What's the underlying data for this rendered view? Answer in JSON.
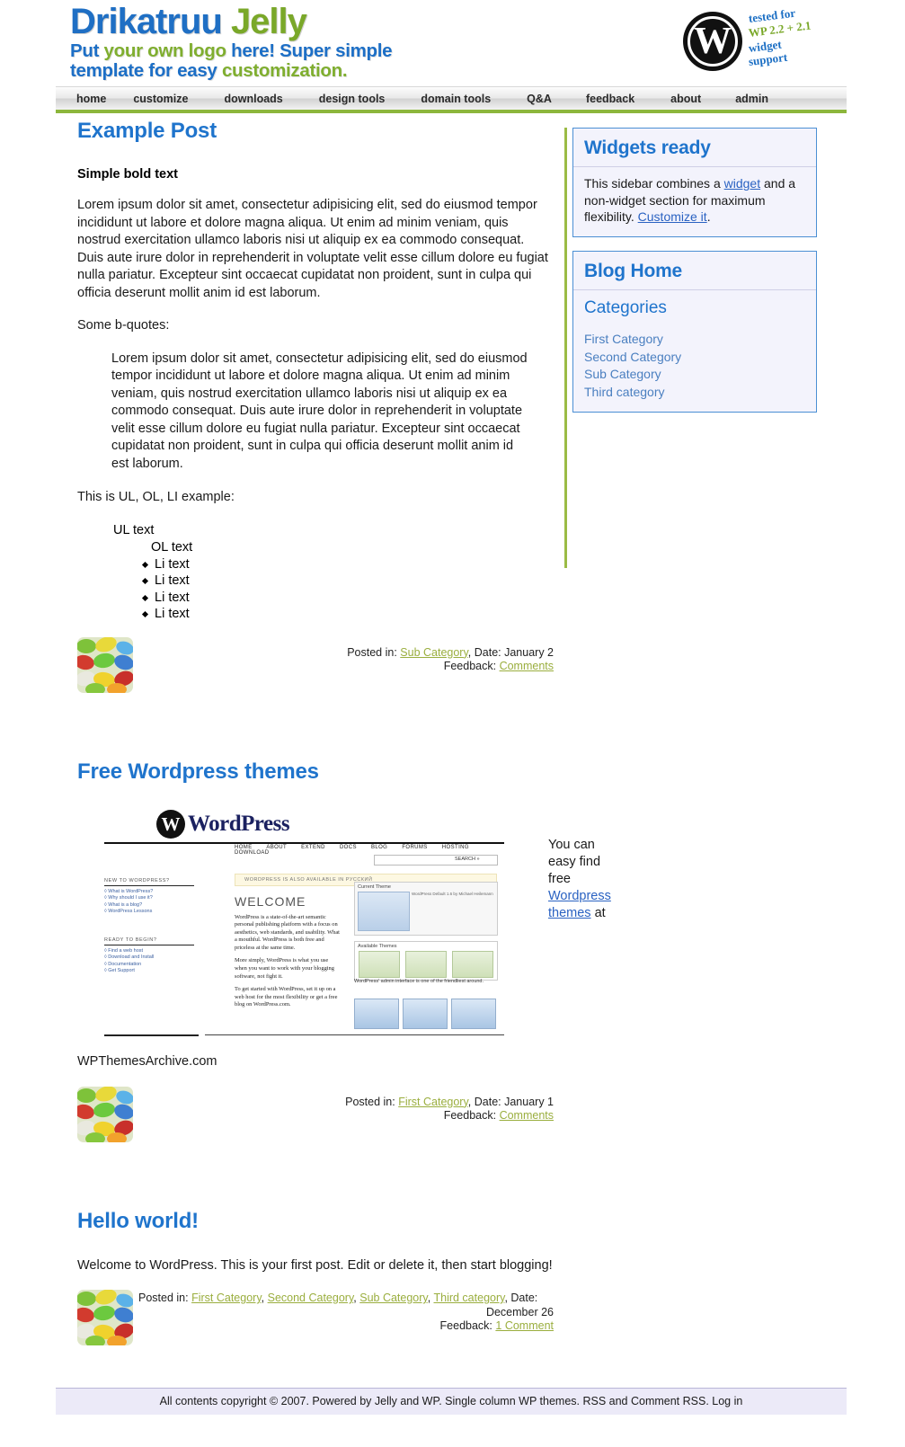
{
  "header": {
    "logo": {
      "line1_part1": "Drikatruu",
      "line1_part2": "Jelly",
      "tag_a": "Put",
      "tag_b": "your own logo",
      "tag_c": "here! Super simple",
      "tag_d": "template for easy",
      "tag_e": "customization."
    },
    "badge": {
      "line1": "tested for",
      "line2": "WP 2.2 + 2.1",
      "line3": "widget",
      "line4": "support",
      "mark_letter": "W"
    }
  },
  "nav": {
    "items": [
      {
        "label": "home"
      },
      {
        "label": "customize"
      },
      {
        "label": "downloads"
      },
      {
        "label": "design tools"
      },
      {
        "label": "domain tools"
      },
      {
        "label": "Q&A"
      },
      {
        "label": "feedback"
      },
      {
        "label": "about"
      },
      {
        "label": "admin"
      }
    ]
  },
  "posts": {
    "post1": {
      "title": "Example Post",
      "bold_lead": "Simple bold text",
      "paragraph": "Lorem ipsum dolor sit amet, consectetur adipisicing elit, sed do eiusmod tempor incididunt ut labore et dolore magna aliqua. Ut enim ad minim veniam, quis nostrud exercitation ullamco laboris nisi ut aliquip ex ea commodo consequat. Duis aute irure dolor in reprehenderit in voluptate velit esse cillum dolore eu fugiat nulla pariatur. Excepteur sint occaecat cupidatat non proident, sunt in culpa qui officia deserunt mollit anim id est laborum.",
      "quote_intro": "Some b-quotes:",
      "blockquote": "Lorem ipsum dolor sit amet, consectetur adipisicing elit, sed do eiusmod tempor incididunt ut labore et dolore magna aliqua. Ut enim ad minim veniam, quis nostrud exercitation ullamco laboris nisi ut aliquip ex ea commodo consequat. Duis aute irure dolor in reprehenderit in voluptate velit esse cillum dolore eu fugiat nulla pariatur. Excepteur sint occaecat cupidatat non proident, sunt in culpa qui officia deserunt mollit anim id est laborum.",
      "list_intro": "This is UL, OL, LI example:",
      "ul_text": "UL text",
      "ol_text": "OL text",
      "li_items": [
        "Li text",
        "Li text",
        "Li text",
        "Li text"
      ],
      "meta": {
        "posted_in_label": "Posted in:",
        "category": "Sub Category",
        "date_label": ", Date: January 2",
        "feedback_label": "Feedback:",
        "feedback_link": "Comments"
      }
    },
    "post2": {
      "title": "Free Wordpress themes",
      "side_text_1": "You can",
      "side_text_2": "easy find",
      "side_text_3": "free",
      "side_link": "Wordpress themes",
      "side_text_4": "at",
      "caption": "WPThemesArchive.com",
      "meta": {
        "posted_in_label": "Posted in:",
        "category": "First Category",
        "date_label": ", Date: January 1",
        "feedback_label": "Feedback:",
        "feedback_link": "Comments"
      },
      "screenshot": {
        "brand_mark": "W",
        "brand": "WordPress",
        "nav": [
          "HOME",
          "ABOUT",
          "EXTEND",
          "DOCS",
          "BLOG",
          "FORUMS",
          "HOSTING",
          "DOWNLOAD"
        ],
        "search_btn": "SEARCH »",
        "notice": "WORDPRESS IS ALSO AVAILABLE IN РУССКИЙ",
        "welcome": "WELCOME",
        "col1_head": "NEW TO WORDPRESS?",
        "col1_items": [
          "What is WordPress?",
          "Why should I use it?",
          "What is a blog?",
          "WordPress Lessons"
        ],
        "col1b_head": "READY TO BEGIN?",
        "col1b_items": [
          "Find a web host",
          "Download and Install",
          "Documentation",
          "Get Support"
        ],
        "body1": "WordPress is a state-of-the-art semantic personal publishing platform with a focus on aesthetics, web standards, and usability. What a mouthful. WordPress is both free and priceless at the same time.",
        "body2": "More simply, WordPress is what you use when you want to work with your blogging software, not fight it.",
        "body3": "To get started with WordPress, set it up on a web host for the most flexibility or get a free blog on WordPress.com.",
        "panel_title": "Current Theme",
        "panel_text": "WordPress Default 1.6 by Michael Heilemann",
        "panel2_title": "Available Themes",
        "caption": "WordPress' admin interface is one of the friendliest around."
      }
    },
    "post3": {
      "title_a": "Hello",
      "title_b": "world!",
      "paragraph": "Welcome to WordPress. This is your first post. Edit or delete it, then start blogging!",
      "meta": {
        "posted_in_label": "Posted in:",
        "categories": [
          "First Category",
          "Second Category",
          "Sub Category",
          "Third category"
        ],
        "date_label": ", Date:",
        "date_value": "December 26",
        "feedback_label": "Feedback:",
        "feedback_link": "1 Comment"
      }
    }
  },
  "sidebar": {
    "widgets_box": {
      "title": "Widgets ready",
      "text_1": "This sidebar combines a ",
      "link_1": "widget",
      "text_2": " and a non-widget section for maximum flexibility. ",
      "link_2": "Customize it",
      "text_3": "."
    },
    "blog_box": {
      "title": "Blog Home",
      "subheading": "Categories",
      "categories": [
        {
          "label": "First Category"
        },
        {
          "label": "Second Category"
        },
        {
          "label": "Sub Category"
        },
        {
          "label": "Third category"
        }
      ]
    }
  },
  "footer": {
    "text": "All contents copyright © 2007. Powered by Jelly and WP. Single column WP themes. RSS and Comment RSS. Log in"
  },
  "colors": {
    "brand_blue": "#1f74cc",
    "brand_green": "#7aa829",
    "nav_underline": "#8cb63c",
    "meta_link": "#9aae3e",
    "sidebar_border": "#4b8fd4",
    "footer_bg": "#eceaf8"
  }
}
